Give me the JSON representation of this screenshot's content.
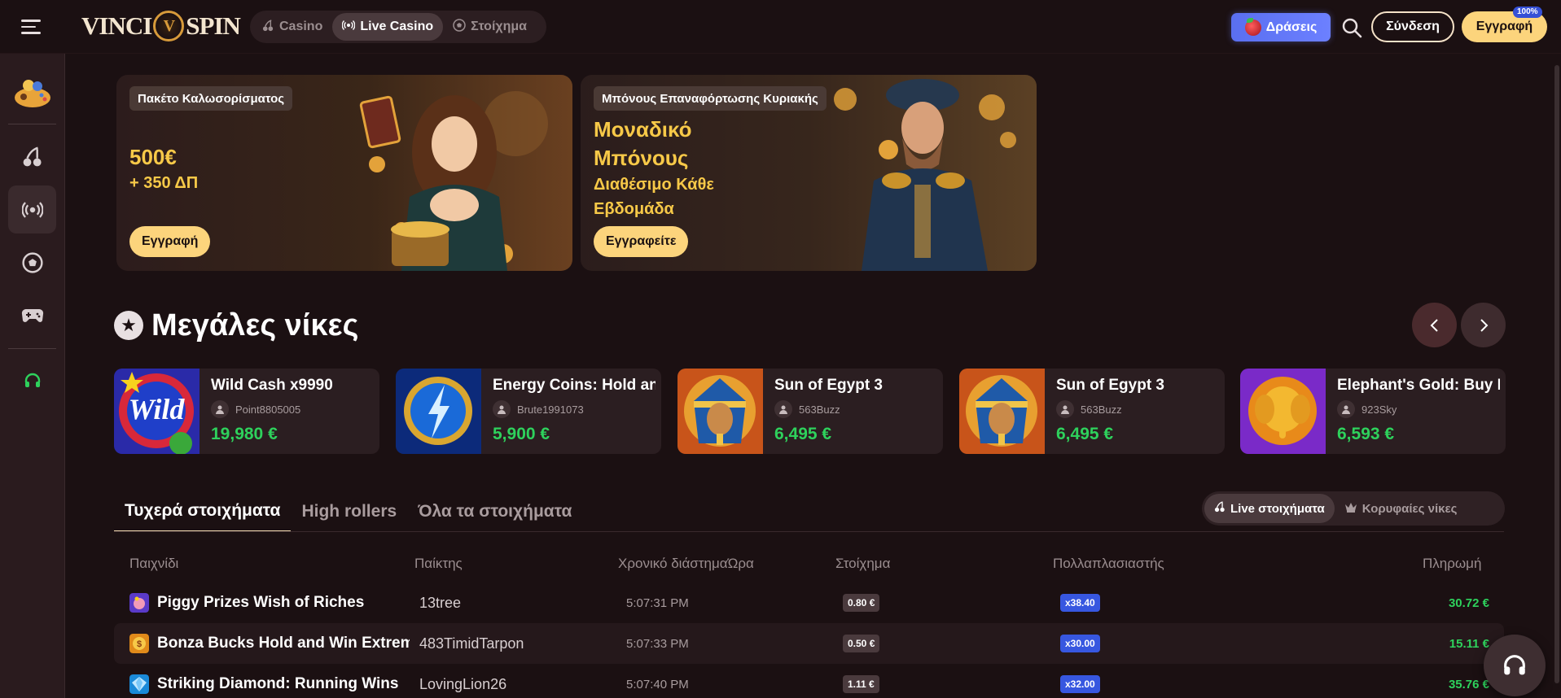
{
  "header": {
    "logo_left": "VINCI",
    "logo_right": "SPIN",
    "nav": [
      {
        "label": "Casino",
        "icon": "cherry-icon"
      },
      {
        "label": "Live Casino",
        "icon": "live-icon"
      },
      {
        "label": "Στοίχημα",
        "icon": "football-icon"
      }
    ],
    "actions_label": "Δράσεις",
    "login_label": "Σύνδεση",
    "register_label": "Εγγραφή",
    "register_badge": "100%"
  },
  "sidebar": {
    "items": [
      "games-icon",
      "cherry-icon",
      "live-icon",
      "football-icon",
      "gamepad-icon",
      "headset-icon"
    ]
  },
  "banners": [
    {
      "tag": "Πακέτο Καλωσορίσματος",
      "amount": "500€",
      "extra": "+ 350 ΔΠ",
      "button": "Εγγραφή"
    },
    {
      "tag": "Μπόνους Επαναφόρτωσης Κυριακής",
      "title_line1": "Μοναδικό",
      "title_line2": "Μπόνους",
      "sub_line1": "Διαθέσιμο Κάθε",
      "sub_line2": "Εβδομάδα",
      "button": "Εγγραφείτε"
    }
  ],
  "big_wins": {
    "title": "Μεγάλες νίκες",
    "cards": [
      {
        "game": "Wild Cash x9990",
        "user": "Point8805005",
        "amount": "19,980 €"
      },
      {
        "game": "Energy Coins: Hold and Win",
        "user": "Brute1991073",
        "amount": "5,900 €"
      },
      {
        "game": "Sun of Egypt 3",
        "user": "563Buzz",
        "amount": "6,495 €"
      },
      {
        "game": "Sun of Egypt 3",
        "user": "563Buzz",
        "amount": "6,495 €"
      },
      {
        "game": "Elephant's Gold: Buy Bonus",
        "user": "923Sky",
        "amount": "6,593 €"
      }
    ]
  },
  "bets": {
    "tabs": [
      "Τυχερά στοιχήματα",
      "High rollers",
      "Όλα τα στοιχήματα"
    ],
    "toggles": [
      "Live στοιχήματα",
      "Κορυφαίες νίκες"
    ],
    "columns": [
      "Παιχνίδι",
      "Παίκτης",
      "Χρονικό διάστημαΏρα",
      "Στοίχημα",
      "Πολλαπλασιαστής",
      "Πληρωμή"
    ],
    "rows": [
      {
        "game": "Piggy Prizes Wish of Riches",
        "player": "13tree",
        "time": "5:07:31 PM",
        "stake": "0.80 €",
        "mult": "x38.40",
        "payout": "30.72 €"
      },
      {
        "game": "Bonza Bucks Hold and Win Extreme",
        "player": "483TimidTarpon",
        "time": "5:07:33 PM",
        "stake": "0.50 €",
        "mult": "x30.00",
        "payout": "15.11 €"
      },
      {
        "game": "Striking Diamond: Running Wins",
        "player": "LovingLion26",
        "time": "5:07:40 PM",
        "stake": "1.11 €",
        "mult": "x32.00",
        "payout": "35.76 €"
      }
    ]
  },
  "colors": {
    "background": "#1b1012",
    "accent_gold": "#fcd47c",
    "win_green": "#2ed15c",
    "mult_blue": "#3757e0"
  }
}
